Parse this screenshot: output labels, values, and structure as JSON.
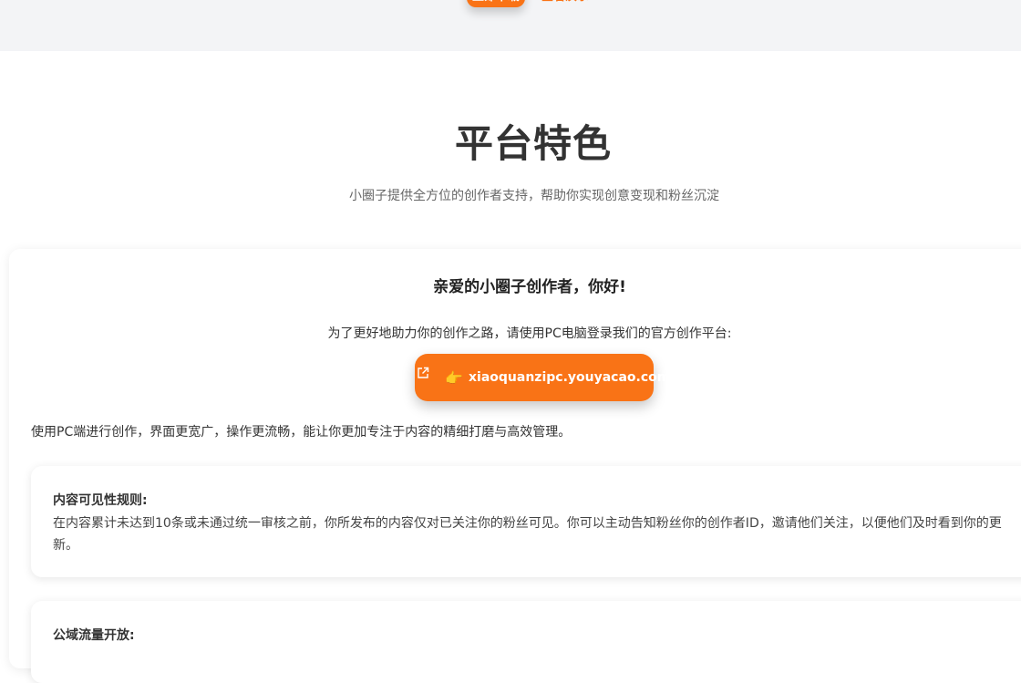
{
  "hero": {
    "primary_button": "立即下载",
    "secondary_link": "查看演示"
  },
  "features": {
    "title": "平台特色",
    "subtitle": "小圈子提供全方位的创作者支持，帮助你实现创意变现和粉丝沉淀"
  },
  "notice": {
    "greeting": "亲爱的小圈子创作者，你好!",
    "intro": "为了更好地助力你的创作之路，请使用PC电脑登录我们的官方创作平台:",
    "link": {
      "hand_glyph": "👉",
      "url": "xiaoquanzipc.youyacao.com",
      "icon": "external-link-icon"
    },
    "pc_note": "使用PC端进行创作，界面更宽广，操作更流畅，能让你更加专注于内容的精细打磨与高效管理。",
    "rules": [
      {
        "title": "内容可见性规则:",
        "body": "在内容累计未达到10条或未通过统一审核之前，你所发布的内容仅对已关注你的粉丝可见。你可以主动告知粉丝你的创作者ID，邀请他们关注，以便他们及时看到你的更新。"
      },
      {
        "title": "公域流量开放:",
        "body": ""
      }
    ]
  },
  "colors": {
    "accent": "#f97316",
    "band": "#f3f4f6"
  }
}
